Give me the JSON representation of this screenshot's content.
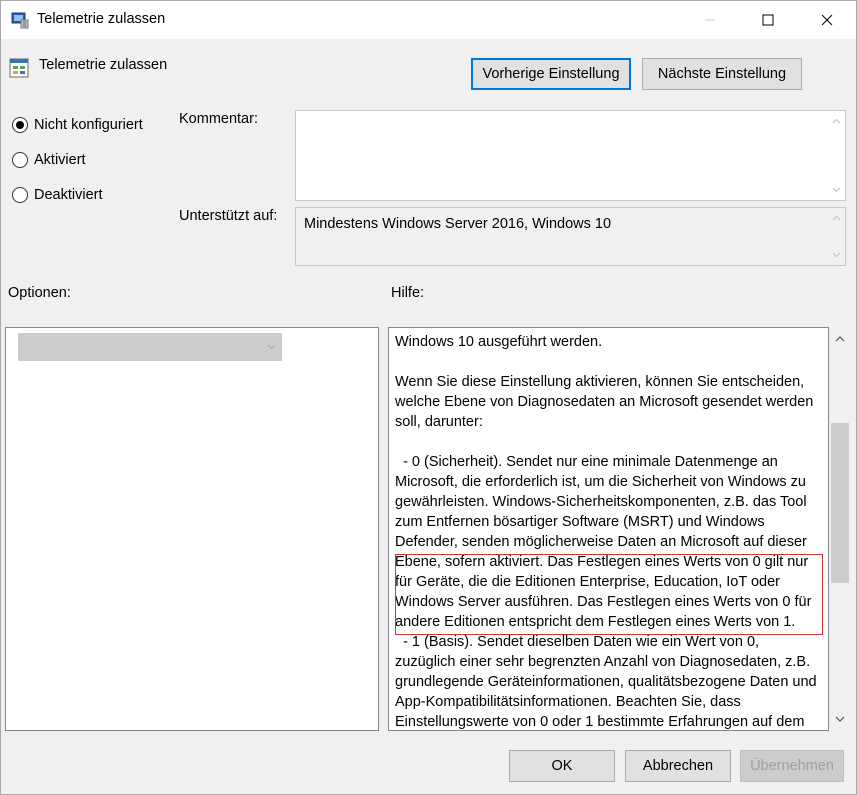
{
  "window": {
    "title": "Telemetrie zulassen",
    "icon": "policy-setting-icon"
  },
  "header": {
    "title": "Telemetrie zulassen",
    "icon": "policy-icon",
    "prev_button": "Vorherige Einstellung",
    "next_button": "Nächste Einstellung"
  },
  "state": {
    "options": [
      {
        "label": "Nicht konfiguriert",
        "checked": true
      },
      {
        "label": "Aktiviert",
        "checked": false
      },
      {
        "label": "Deaktiviert",
        "checked": false
      }
    ]
  },
  "comment": {
    "label": "Kommentar:",
    "value": ""
  },
  "supported": {
    "label": "Unterstützt auf:",
    "value": "Mindestens Windows Server 2016, Windows 10"
  },
  "sections": {
    "options_label": "Optionen:",
    "help_label": "Hilfe:"
  },
  "options_combo": {
    "value": ""
  },
  "help": {
    "paragraphs": [
      "Windows 10 ausgeführt werden.",
      "",
      "Wenn Sie diese Einstellung aktivieren, können Sie entscheiden, welche Ebene von Diagnosedaten an Microsoft gesendet werden soll, darunter:",
      "",
      "  - 0 (Sicherheit). Sendet nur eine minimale Datenmenge an Microsoft, die erforderlich ist, um die Sicherheit von Windows zu gewährleisten. Windows-Sicherheitskomponenten, z.B. das Tool zum Entfernen bösartiger Software (MSRT) und Windows Defender, senden möglicherweise Daten an Microsoft auf dieser Ebene, sofern aktiviert. Das Festlegen eines Werts von 0 gilt nur für Geräte, die die Editionen Enterprise, Education, IoT oder Windows Server ausführen. Das Festlegen eines Werts von 0 für andere Editionen entspricht dem Festlegen eines Werts von 1.",
      "  - 1 (Basis). Sendet dieselben Daten wie ein Wert von 0, zuzüglich einer sehr begrenzten Anzahl von Diagnosedaten, z.B. grundlegende Geräteinformationen, qualitätsbezogene Daten und App-Kompatibilitätsinformationen. Beachten Sie, dass Einstellungswerte von 0 oder 1 bestimmte Erfahrungen auf dem"
    ]
  },
  "footer": {
    "ok": "OK",
    "cancel": "Abbrechen",
    "apply": "Übernehmen"
  },
  "colors": {
    "focus_border": "#0078d7",
    "highlight_border": "#d33333"
  }
}
